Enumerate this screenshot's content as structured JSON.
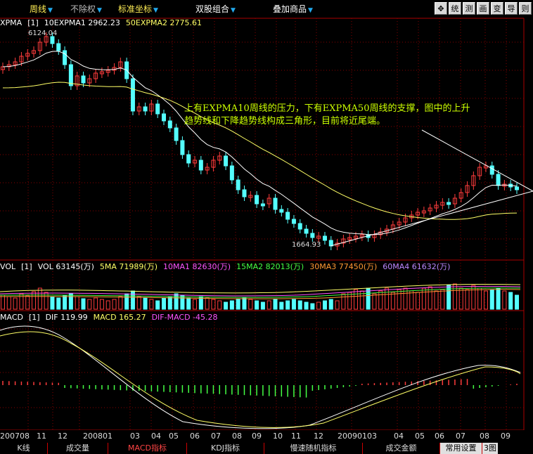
{
  "toolbar": {
    "period": "周线",
    "adjust": "不除权",
    "coords": "标准坐标",
    "combo": "双股组合",
    "overlay": "叠加商品",
    "buttons": [
      {
        "name": "move-icon",
        "label": "✥"
      },
      {
        "name": "tongji-button",
        "label": "统"
      },
      {
        "name": "ce-button",
        "label": "测"
      },
      {
        "name": "hua-button",
        "label": "画"
      },
      {
        "name": "bian-button",
        "label": "变"
      },
      {
        "name": "daochu-button",
        "label": "导"
      },
      {
        "name": "ze-button",
        "label": "则"
      }
    ]
  },
  "main_header": {
    "name": "XPMA",
    "param": "[1]",
    "ma1": "10EXPMA1 2962.23",
    "ma2": "50EXPMA2 2775.61"
  },
  "price_labels": {
    "high": "6124.04",
    "low": "1664.93"
  },
  "annotation": {
    "line1": "上有EXPMA10周线的压力，下有EXPMA50周线的支撑，图中的上升",
    "line2": "趋势线和下降趋势线构成三角形，目前将近尾端。"
  },
  "vol_header": {
    "name": "VOL",
    "param": "[1]",
    "vol": "VOL 63145(万)",
    "ma5": "5MA 71989(万)",
    "ma10": "10MA1 82630(万)",
    "ma15": "15MA2 82013(万)",
    "ma30": "30MA3 77450(万)",
    "ma60": "60MA4 61632(万)"
  },
  "macd_header": {
    "name": "MACD",
    "param": "[1]",
    "dif": "DIF 119.99",
    "macd": "MACD 165.27",
    "difmacd": "DIF-MACD -45.28"
  },
  "xaxis": [
    "200708",
    "11",
    "12",
    "200801",
    "03",
    "04",
    "05",
    "06",
    "07",
    "08",
    "09",
    "10",
    "11",
    "12",
    "20090103",
    "04",
    "05",
    "06",
    "07",
    "08",
    "09"
  ],
  "tabs": [
    "K线",
    "成交量",
    "MACD指标",
    "KDJ指标",
    "慢速随机指标",
    "成交金额",
    "常用设置",
    "3图"
  ],
  "colors": {
    "up": "#ff3c3c",
    "down": "#54ffff",
    "ma_white": "#ffffff",
    "ma_yellow": "#ffff66",
    "annotation": "#ccff00",
    "grid": "#880000"
  }
}
